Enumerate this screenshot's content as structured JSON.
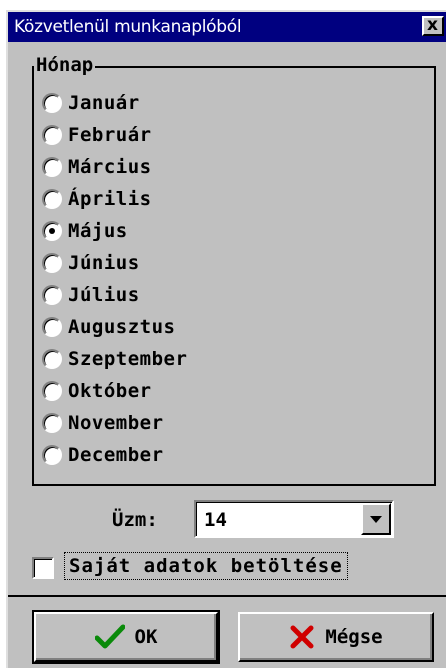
{
  "window": {
    "title": "Közvetlenül munkanaplóból",
    "close_glyph": "x"
  },
  "month_group": {
    "title": "Hónap",
    "months": [
      {
        "label": "Január",
        "checked": false
      },
      {
        "label": "Február",
        "checked": false
      },
      {
        "label": "Március",
        "checked": false
      },
      {
        "label": "Április",
        "checked": false
      },
      {
        "label": "Május",
        "checked": true
      },
      {
        "label": "Június",
        "checked": false
      },
      {
        "label": "Július",
        "checked": false
      },
      {
        "label": "Augusztus",
        "checked": false
      },
      {
        "label": "Szeptember",
        "checked": false
      },
      {
        "label": "Október",
        "checked": false
      },
      {
        "label": "November",
        "checked": false
      },
      {
        "label": "December",
        "checked": false
      }
    ]
  },
  "uzm": {
    "label": "Üzm:",
    "value": "14"
  },
  "own_data": {
    "label": "Saját adatok betöltése",
    "checked": false
  },
  "buttons": {
    "ok_label": "OK",
    "cancel_label": "Mégse"
  },
  "colors": {
    "titlebar": "#000080",
    "face": "#c0c0c0",
    "ok_icon": "#0a8a0a",
    "cancel_icon": "#d00000"
  },
  "icons": {
    "ok": "checkmark-icon",
    "cancel": "x-icon",
    "dropdown": "chevron-down-icon"
  }
}
